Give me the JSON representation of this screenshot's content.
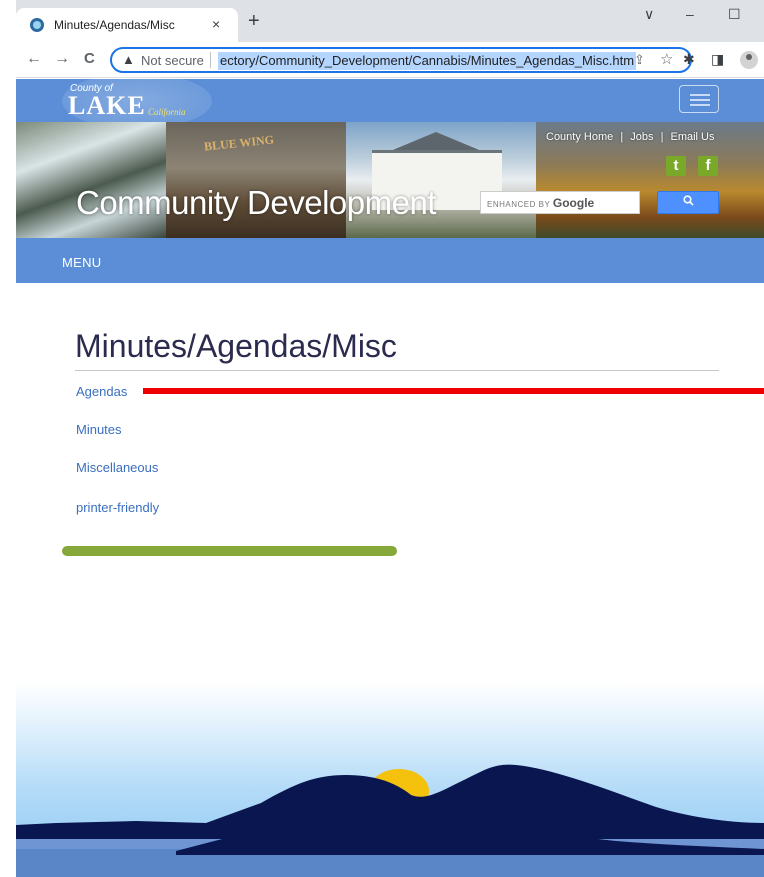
{
  "browser": {
    "tab_title": "Minutes/Agendas/Misc",
    "tab_close": "×",
    "new_tab": "+",
    "win_collapse": "∨",
    "win_minimize": "–",
    "win_maximize": "☐",
    "back": "←",
    "forward": "→",
    "reload": "C",
    "security_text": "Not secure",
    "url": "ectory/Community_Development/Cannabis/Minutes_Agendas_Misc.htm",
    "share_icon": "⇪",
    "bookmark_icon": "☆",
    "extensions_icon": "✱",
    "sidepanel_icon": "◨"
  },
  "site": {
    "logo_county": "County of",
    "logo_lake": "LAKE",
    "logo_california": "California",
    "title": "Community Development",
    "links": [
      "County Home",
      "Jobs",
      "Email Us"
    ],
    "link_separator": "|",
    "social": [
      "t",
      "f"
    ],
    "search_placeholder_small": "ENHANCED BY",
    "search_placeholder_brand": "Google",
    "search_button_icon": "🔍",
    "menu_label": "MENU"
  },
  "content": {
    "heading": "Minutes/Agendas/Misc",
    "links": [
      "Agendas",
      "Minutes",
      "Miscellaneous",
      "printer-friendly"
    ]
  },
  "colors": {
    "header_blue": "#5b8ed6",
    "link_blue": "#3a6fbf",
    "highlight_red": "#ee0000",
    "accent_green": "#86a73a",
    "hill_navy": "#0a1650",
    "sun_yellow": "#f4c20d"
  }
}
